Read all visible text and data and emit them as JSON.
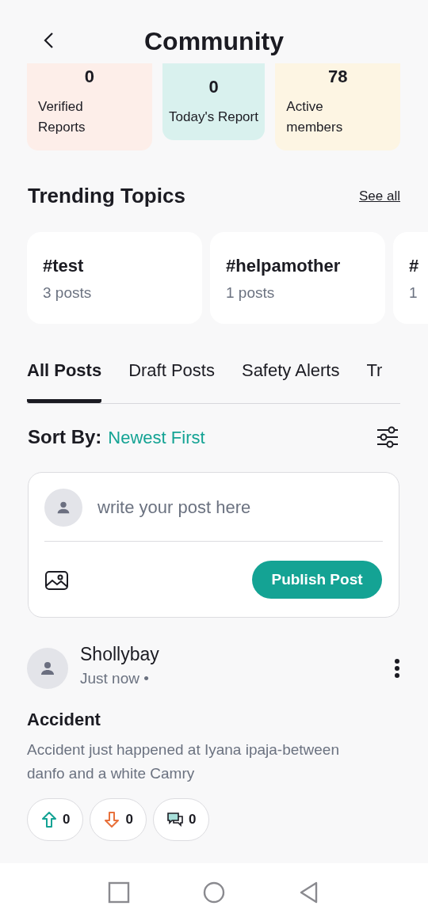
{
  "header": {
    "title": "Community"
  },
  "stats": [
    {
      "value": "0",
      "label": "Verified Reports",
      "color": "#fdeee9"
    },
    {
      "value": "0",
      "label": "Today's Report",
      "color": "#d9f1ee"
    },
    {
      "value": "78",
      "label": "Active members",
      "color": "#fdf5e3"
    }
  ],
  "trending": {
    "title": "Trending Topics",
    "link": "See all",
    "topics": [
      {
        "tag": "#test",
        "count": "3 posts"
      },
      {
        "tag": "#helpamother",
        "count": "1 posts"
      },
      {
        "tag": "#",
        "count": "1"
      }
    ]
  },
  "tabs": [
    {
      "label": "All Posts",
      "selected": true
    },
    {
      "label": "Draft Posts",
      "selected": false
    },
    {
      "label": "Safety Alerts",
      "selected": false
    },
    {
      "label": "Tr",
      "selected": false
    }
  ],
  "sort": {
    "label": "Sort By:",
    "value": "Newest First"
  },
  "composer": {
    "placeholder": "write your post here",
    "button": "Publish Post"
  },
  "posts": [
    {
      "author": "Shollybay",
      "time": "Just now •",
      "title": "Accident",
      "body": "Accident just happened at Iyana ipaja-between danfo and a white Camry",
      "upvotes": "0",
      "downvotes": "0",
      "comments": "0"
    }
  ]
}
